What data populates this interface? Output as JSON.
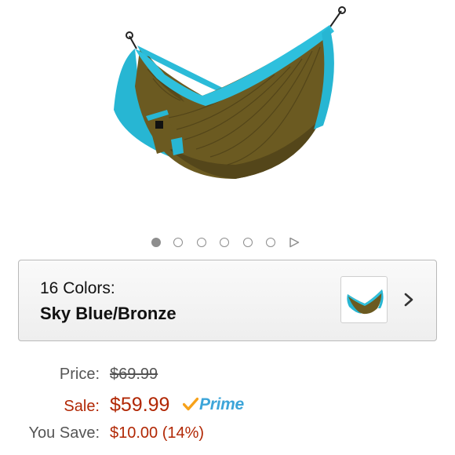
{
  "product_image": {
    "alt": "hammock-image",
    "colors": {
      "body": "#6b5a21",
      "body_shade": "#54461a",
      "trim": "#27b6d3"
    }
  },
  "carousel": {
    "total_slides": 6,
    "active_index": 0,
    "has_video": true
  },
  "color_selector": {
    "count_label": "16 Colors:",
    "selected_name": "Sky Blue/Bronze",
    "chevron_icon": "chevron-right-icon"
  },
  "pricing": {
    "list_price_label": "Price:",
    "list_price": "$69.99",
    "sale_label": "Sale:",
    "sale_price": "$59.99",
    "prime_label": "Prime",
    "savings_label": "You Save:",
    "savings_value": "$10.00 (14%)",
    "accent_color": "#b12704",
    "prime_color": "#3da5d9",
    "prime_check_color": "#f7a21b"
  }
}
